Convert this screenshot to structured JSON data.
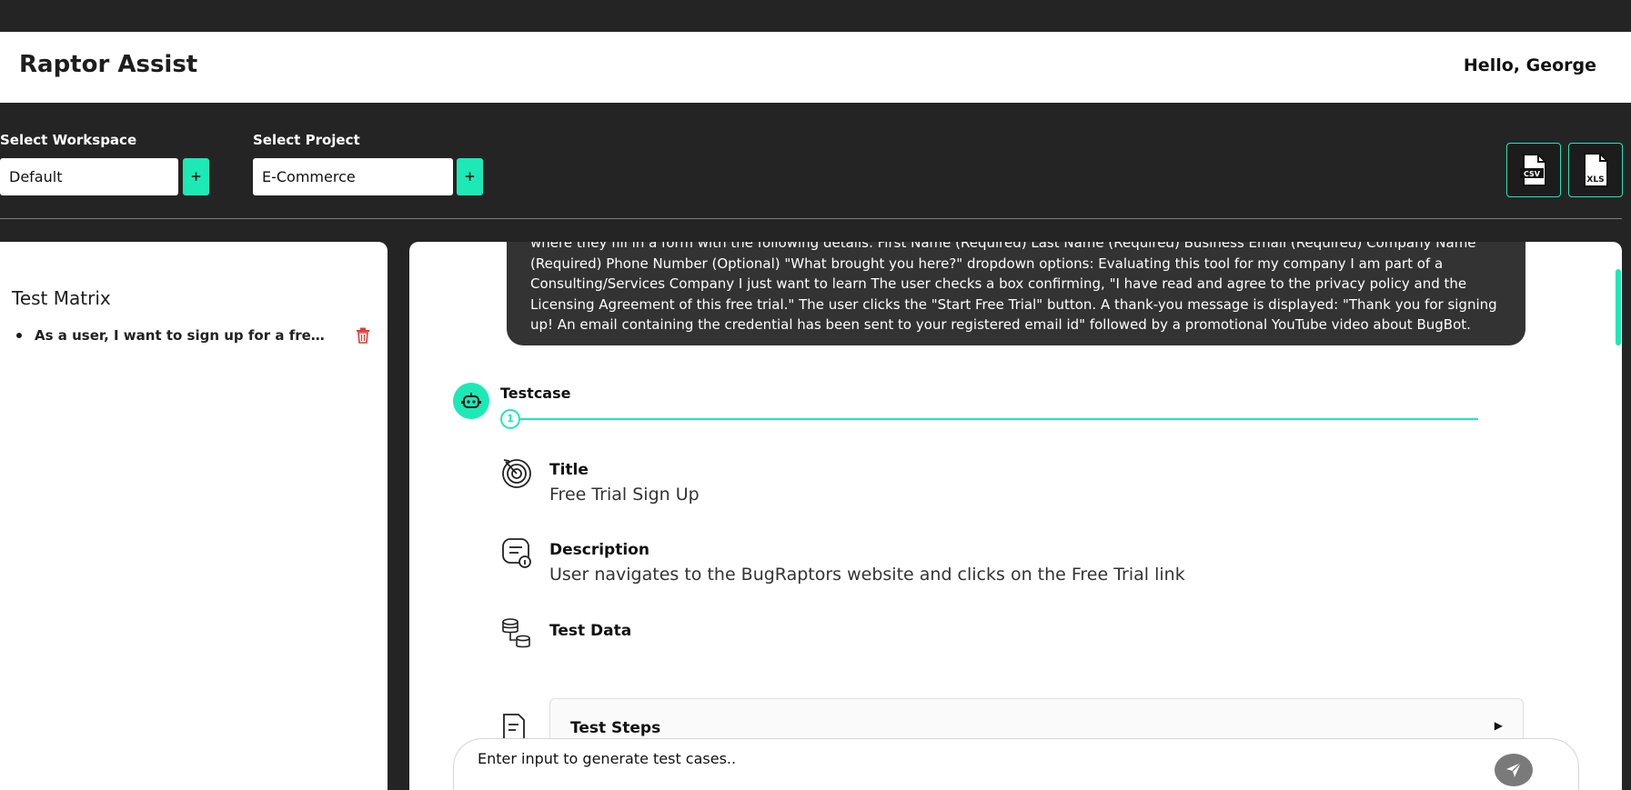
{
  "app": {
    "title": "Raptor Assist",
    "greeting": "Hello, George"
  },
  "toolbar": {
    "workspace": {
      "label": "Select Workspace",
      "value": "Default",
      "add_label": "+"
    },
    "project": {
      "label": "Select Project",
      "value": "E-Commerce",
      "add_label": "+"
    },
    "downloads": [
      {
        "icon": "csv-file-icon",
        "label": "CSV"
      },
      {
        "icon": "xls-file-icon",
        "label": "XLS"
      }
    ]
  },
  "sidebar": {
    "title": "Test Matrix",
    "items": [
      {
        "text": "As a user, I want to sign up for a free trial",
        "icon": "trash-icon"
      }
    ]
  },
  "chat": {
    "user_message": "where they fill in a form with the following details: First Name (Required) Last Name (Required) Business Email (Required) Company Name (Required) Phone Number (Optional) \"What brought you here?\" dropdown options: Evaluating this tool for my company I am part of a Consulting/Services Company I just want to learn The user checks a box confirming, \"I have read and agree to the privacy policy and the Licensing Agreement of this free trial.\" The user clicks the \"Start Free Trial\" button. A thank-you message is displayed: \"Thank you for signing up! An email containing the credential has been sent to your registered email id\" followed by a promotional YouTube video about BugBot.",
    "testcase": {
      "label": "Testcase",
      "step_number": "1",
      "title_label": "Title",
      "title_value": "Free Trial Sign Up",
      "description_label": "Description",
      "description_value": "User navigates to the BugRaptors website and clicks on the Free Trial link",
      "test_data_label": "Test Data",
      "test_steps_label": "Test Steps",
      "expand_arrow": "▶"
    },
    "input": {
      "placeholder": "Enter input to generate test cases.."
    }
  },
  "colors": {
    "accent": "#1de9b6",
    "dark": "#242424",
    "bubble": "#333333",
    "danger": "#e53935"
  }
}
